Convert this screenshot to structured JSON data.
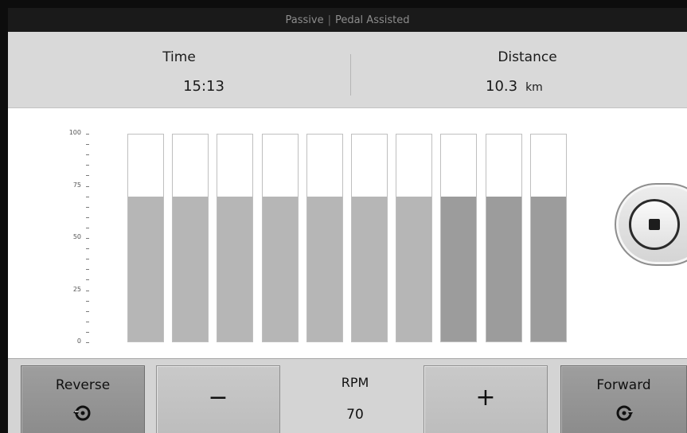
{
  "status_bar": {
    "mode": "Passive",
    "assist": "Pedal Assisted"
  },
  "stats": {
    "time": {
      "label": "Time",
      "value": "15:13"
    },
    "distance": {
      "label": "Distance",
      "value": "10.3",
      "unit": "km"
    }
  },
  "chart_data": {
    "type": "bar",
    "title": "",
    "ylim": [
      0,
      100
    ],
    "y_ticks": [
      "100",
      "75",
      "50",
      "25",
      "0"
    ],
    "categories": [
      "",
      "",
      "",
      "",
      "",
      "",
      "",
      "",
      "",
      ""
    ],
    "values": [
      70,
      70,
      70,
      70,
      70,
      70,
      70,
      70,
      70,
      70
    ],
    "max_values": [
      100,
      100,
      100,
      100,
      100,
      100,
      100,
      100,
      100,
      100
    ],
    "highlighted_bars": [
      7,
      8,
      9
    ],
    "colors": {
      "fill": "#b6b6b6",
      "fill_highlight": "#9c9c9c",
      "outline": "#bfbfbf"
    }
  },
  "controls": {
    "stop_icon": "stop-icon",
    "reverse": {
      "label": "Reverse",
      "icon": "rotate-ccw-icon"
    },
    "decrease": {
      "symbol": "−"
    },
    "rpm": {
      "label": "RPM",
      "value": "70"
    },
    "increase": {
      "symbol": "+"
    },
    "forward": {
      "label": "Forward",
      "icon": "rotate-cw-icon"
    }
  }
}
